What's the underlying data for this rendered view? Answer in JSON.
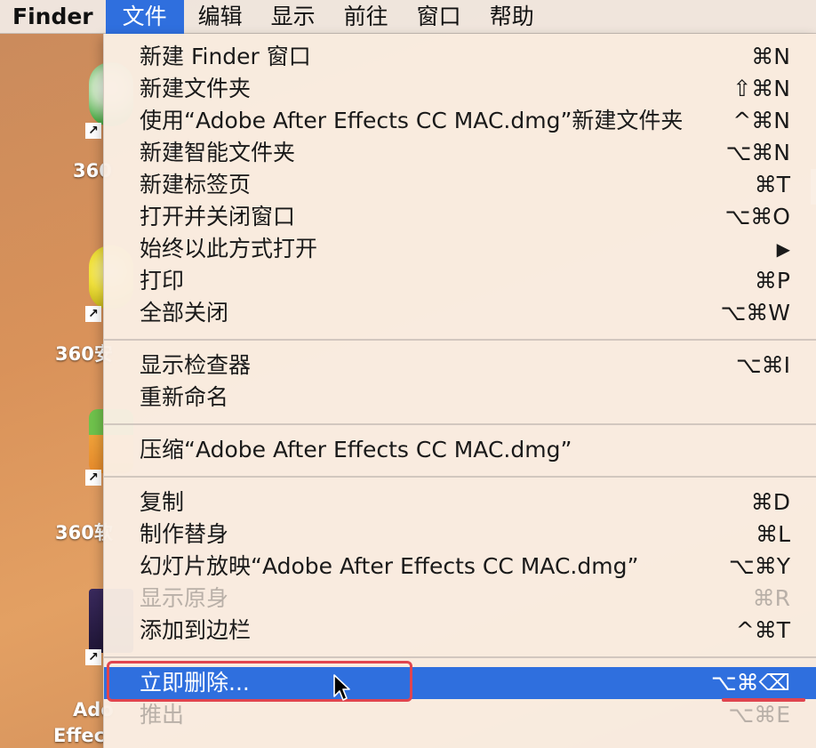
{
  "menubar": {
    "app_name": "Finder",
    "menus": [
      "文件",
      "编辑",
      "显示",
      "前往",
      "窗口",
      "帮助"
    ]
  },
  "desktop": {
    "labels": [
      "360",
      "360安",
      "360软",
      "Ado",
      "Effec"
    ]
  },
  "file_menu": {
    "items": [
      {
        "label": "新建 Finder 窗口",
        "shortcut": "⌘N"
      },
      {
        "label": "新建文件夹",
        "shortcut": "⇧⌘N"
      },
      {
        "label": "使用“Adobe After Effects CC MAC.dmg”新建文件夹",
        "shortcut": "^⌘N"
      },
      {
        "label": "新建智能文件夹",
        "shortcut": "⌥⌘N"
      },
      {
        "label": "新建标签页",
        "shortcut": "⌘T"
      },
      {
        "label": "打开并关闭窗口",
        "shortcut": "⌥⌘O"
      },
      {
        "label": "始终以此方式打开",
        "shortcut": "▶"
      },
      {
        "label": "打印",
        "shortcut": "⌘P"
      },
      {
        "label": "全部关闭",
        "shortcut": "⌥⌘W"
      },
      {
        "label": "显示检查器",
        "shortcut": "⌥⌘I"
      },
      {
        "label": "重新命名",
        "shortcut": ""
      },
      {
        "label": "压缩“Adobe After Effects CC MAC.dmg”",
        "shortcut": ""
      },
      {
        "label": "复制",
        "shortcut": "⌘D"
      },
      {
        "label": "制作替身",
        "shortcut": "⌘L"
      },
      {
        "label": "幻灯片放映“Adobe After Effects CC MAC.dmg”",
        "shortcut": "⌥⌘Y"
      },
      {
        "label": "显示原身",
        "shortcut": "⌘R"
      },
      {
        "label": "添加到边栏",
        "shortcut": "^⌘T"
      },
      {
        "label": "立即删除...",
        "shortcut": "⌥⌘⌫"
      },
      {
        "label": "推出",
        "shortcut": "⌥⌘E"
      }
    ]
  },
  "colors": {
    "highlight": "#2f6fde",
    "annotation": "#e0454f"
  }
}
